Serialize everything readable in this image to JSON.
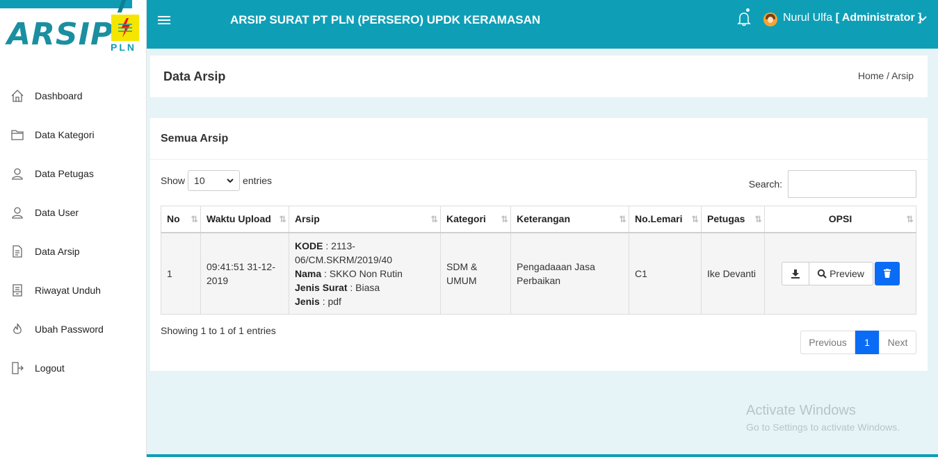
{
  "brand": {
    "logo_text": "ARSIP",
    "pln_text": "PLN",
    "colors": {
      "primary": "#0e9fb7",
      "accent": "#0a6cf5",
      "pln_yellow": "#f5e600"
    }
  },
  "header": {
    "menu_icon": "hamburger-icon",
    "title": "ARSIP SURAT PT PLN (PERSERO) UPDK KERAMASAN",
    "user_name": "Nurul Ulfa",
    "user_role": "[ Administrator ]"
  },
  "sidebar": {
    "items": [
      {
        "label": "Dashboard",
        "icon": "home-icon"
      },
      {
        "label": "Data Kategori",
        "icon": "folder-icon"
      },
      {
        "label": "Data Petugas",
        "icon": "user-icon"
      },
      {
        "label": "Data User",
        "icon": "user-icon"
      },
      {
        "label": "Data Arsip",
        "icon": "document-icon"
      },
      {
        "label": "Riwayat Unduh",
        "icon": "archive-icon"
      },
      {
        "label": "Ubah Password",
        "icon": "flame-icon"
      },
      {
        "label": "Logout",
        "icon": "exit-icon"
      }
    ]
  },
  "page": {
    "title": "Data Arsip",
    "breadcrumb": "Home / Arsip"
  },
  "card": {
    "title": "Semua Arsip",
    "show_label": "Show",
    "entries_label": "entries",
    "page_length": "10",
    "search_label": "Search:",
    "search_value": ""
  },
  "table": {
    "headers": [
      "No",
      "Waktu Upload",
      "Arsip",
      "Kategori",
      "Keterangan",
      "No.Lemari",
      "Petugas",
      "OPSI"
    ],
    "rows": [
      {
        "no": "1",
        "waktu": "09:41:51 31-12-2019",
        "kode_label": "KODE",
        "kode": " : 2113-06/CM.SKRM/2019/40",
        "nama_label": "Nama",
        "nama": " : SKKO Non Rutin",
        "jenis_surat_label": "Jenis Surat",
        "jenis_surat": " : Biasa",
        "jenis_label": "Jenis",
        "jenis": " : pdf",
        "kategori": "SDM & UMUM",
        "keterangan": "Pengadaaan Jasa Perbaikan",
        "lemari": "C1",
        "petugas": "Ike Devanti",
        "preview_label": "Preview"
      }
    ]
  },
  "footer": {
    "info": "Showing 1 to 1 of 1 entries",
    "previous": "Previous",
    "current_page": "1",
    "next": "Next"
  },
  "watermark": {
    "line1": "Activate Windows",
    "line2": "Go to Settings to activate Windows."
  }
}
